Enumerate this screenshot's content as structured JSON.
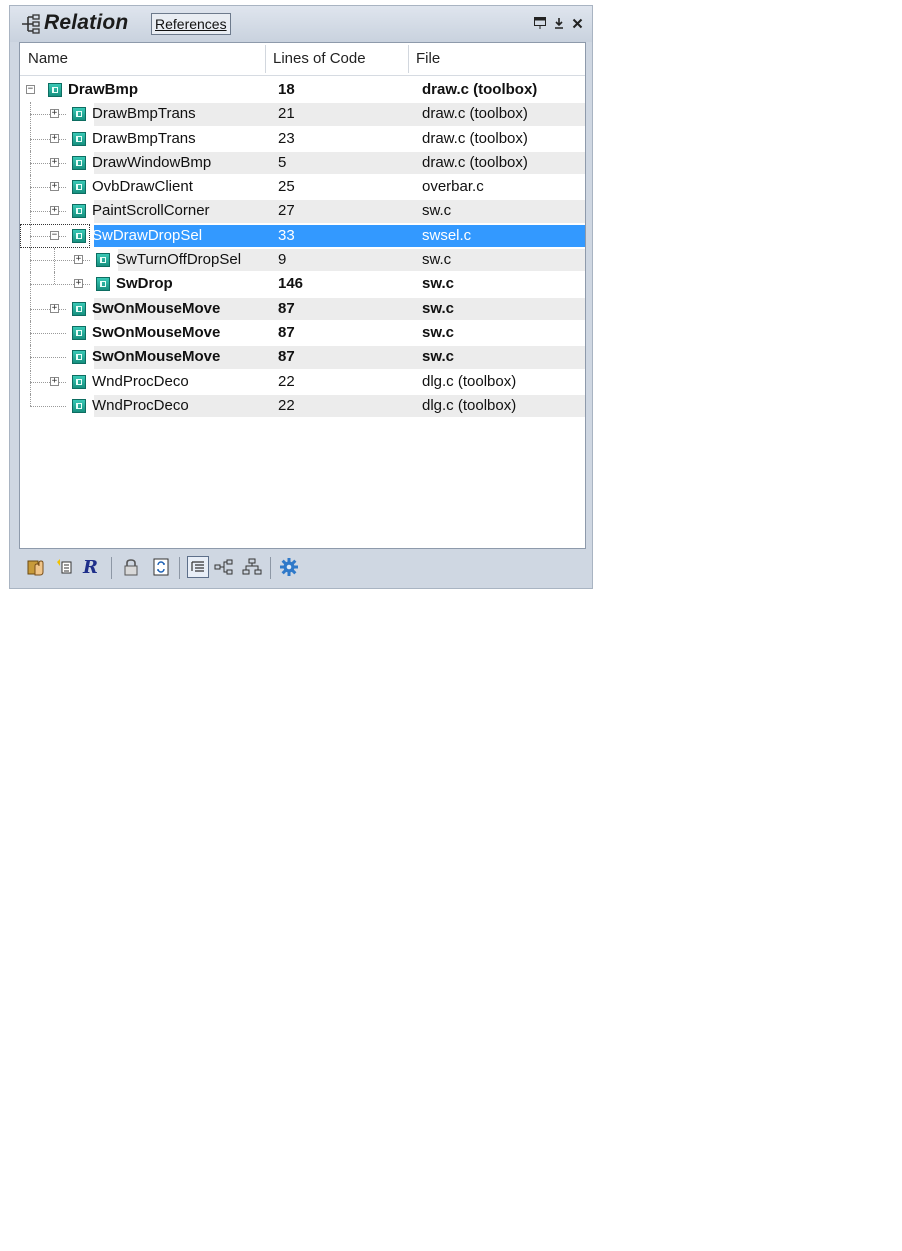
{
  "panel": {
    "title": "Relation",
    "tab_label": "References",
    "buttons": [
      "dock-icon",
      "pin-icon",
      "close-icon"
    ]
  },
  "columns": [
    "Name",
    "Lines of Code",
    "File"
  ],
  "rows": [
    {
      "name": "DrawBmp",
      "loc": "18",
      "file": "draw.c (toolbox)",
      "bold": true,
      "level": 0,
      "expander": "minus"
    },
    {
      "name": "DrawBmpTrans",
      "loc": "21",
      "file": "draw.c (toolbox)",
      "bold": false,
      "level": 1,
      "expander": "plus"
    },
    {
      "name": "DrawBmpTrans",
      "loc": "23",
      "file": "draw.c (toolbox)",
      "bold": false,
      "level": 1,
      "expander": "plus"
    },
    {
      "name": "DrawWindowBmp",
      "loc": "5",
      "file": "draw.c (toolbox)",
      "bold": false,
      "level": 1,
      "expander": "plus"
    },
    {
      "name": "OvbDrawClient",
      "loc": "25",
      "file": "overbar.c",
      "bold": false,
      "level": 1,
      "expander": "plus"
    },
    {
      "name": "PaintScrollCorner",
      "loc": "27",
      "file": "sw.c",
      "bold": false,
      "level": 1,
      "expander": "plus"
    },
    {
      "name": "SwDrawDropSel",
      "loc": "33",
      "file": "swsel.c",
      "bold": false,
      "level": 1,
      "expander": "minus",
      "selected": true
    },
    {
      "name": "SwTurnOffDropSel",
      "loc": "9",
      "file": "sw.c",
      "bold": false,
      "level": 2,
      "expander": "plus"
    },
    {
      "name": "SwDrop",
      "loc": "146",
      "file": "sw.c",
      "bold": true,
      "level": 2,
      "expander": "plus"
    },
    {
      "name": "SwOnMouseMove",
      "loc": "87",
      "file": "sw.c",
      "bold": true,
      "level": 1,
      "expander": "plus"
    },
    {
      "name": "SwOnMouseMove",
      "loc": "87",
      "file": "sw.c",
      "bold": true,
      "level": 1,
      "expander": "none"
    },
    {
      "name": "SwOnMouseMove",
      "loc": "87",
      "file": "sw.c",
      "bold": true,
      "level": 1,
      "expander": "none"
    },
    {
      "name": "WndProcDeco",
      "loc": "22",
      "file": "dlg.c (toolbox)",
      "bold": false,
      "level": 1,
      "expander": "plus"
    },
    {
      "name": "WndProcDeco",
      "loc": "22",
      "file": "dlg.c (toolbox)",
      "bold": false,
      "level": 1,
      "expander": "none"
    }
  ],
  "toolbar": [
    "hand-report-icon",
    "new-relation-icon",
    "r-script-icon",
    "lock-icon",
    "sync-icon",
    "outline-view-icon",
    "horizontal-tree-icon",
    "vertical-tree-icon",
    "settings-gear-icon"
  ],
  "colors": {
    "selection": "#3399ff",
    "zebra": "#ececec",
    "panel": "#cfd7e2",
    "icon_teal": "#1fa694"
  }
}
